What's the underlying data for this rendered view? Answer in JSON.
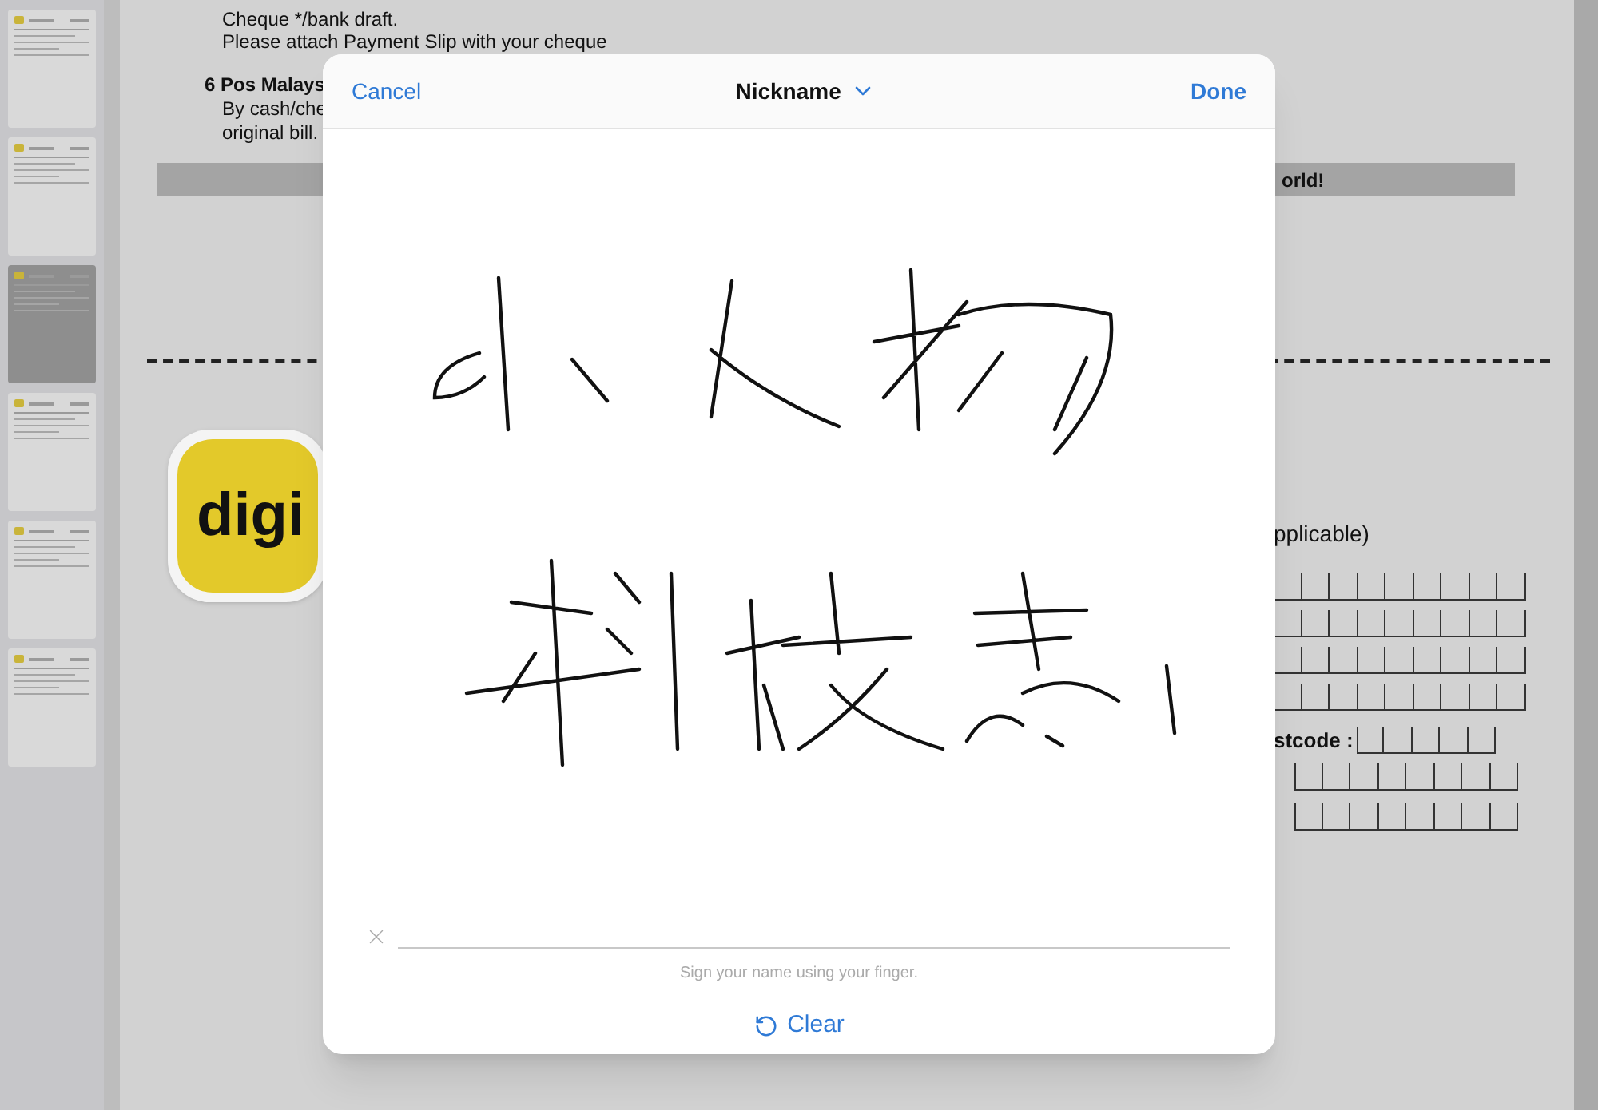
{
  "sidebar": {
    "thumbnails": [
      {
        "selected": false
      },
      {
        "selected": false
      },
      {
        "selected": true
      },
      {
        "selected": false
      },
      {
        "selected": false
      },
      {
        "selected": false
      }
    ]
  },
  "document": {
    "top_lines": [
      "Cheque */bank draft.",
      "Please attach Payment Slip with your cheque"
    ],
    "method_heading": "6 Pos Malays",
    "method_lines": [
      "By cash/che",
      "original bill."
    ],
    "banner": "orld!",
    "logo": "digi",
    "form_note": "pplicable)",
    "postcode_label": "stcode :"
  },
  "dialog": {
    "cancel": "Cancel",
    "title": "Nickname",
    "done": "Done",
    "hint": "Sign your name using your finger.",
    "clear": "Clear"
  }
}
